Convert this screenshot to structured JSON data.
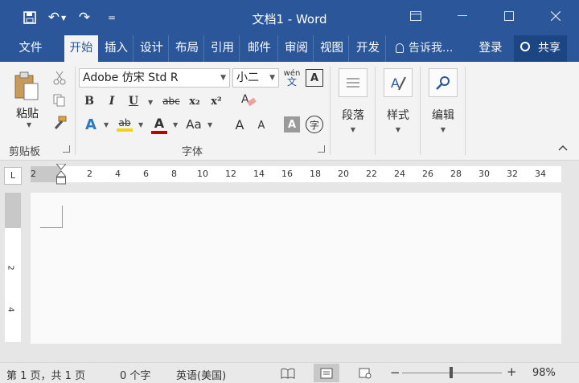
{
  "window": {
    "title": "文档1 - Word"
  },
  "qat": {
    "save": "💾",
    "undo": "↶",
    "redo": "↷",
    "customize": "="
  },
  "tabs": [
    "文件",
    "开始",
    "插入",
    "设计",
    "布局",
    "引用",
    "邮件",
    "审阅",
    "视图",
    "开发"
  ],
  "active_tab": "开始",
  "tellme": "告诉我...",
  "signin": "登录",
  "share": "共享",
  "clipboard": {
    "paste": "粘贴",
    "group": "剪贴板"
  },
  "font": {
    "name": "Adobe 仿宋 Std R",
    "size": "小二",
    "wen_pinyin": "wén",
    "wen_char": "文",
    "border_char": "A",
    "bold": "B",
    "italic": "I",
    "underline": "U",
    "strike": "abc",
    "sub": "x₂",
    "sup": "x²",
    "effects": "A",
    "highlight": "ab",
    "color": "A",
    "case": "Aa",
    "grow": "A",
    "shrink": "A",
    "shade": "A",
    "enclose": "字",
    "group": "字体"
  },
  "paragraph": {
    "label": "段落"
  },
  "styles": {
    "label": "样式"
  },
  "editing": {
    "label": "编辑"
  },
  "ruler": {
    "corner": "L",
    "h_ticks": [
      "2",
      "2",
      "4",
      "6",
      "8",
      "10",
      "12",
      "14",
      "16",
      "18",
      "20",
      "22",
      "24",
      "26",
      "28",
      "30",
      "32",
      "34"
    ],
    "v_ticks": [
      "2",
      "4"
    ]
  },
  "status": {
    "page": "第 1 页，共 1 页",
    "words": "0 个字",
    "lang": "英语(美国)",
    "zoom": "98%",
    "zoom_minus": "−",
    "zoom_plus": "+"
  },
  "zoom_level": 0.98,
  "colors": {
    "accent": "#2b579a",
    "highlight": "#f6d30f",
    "font_color": "#c00000"
  }
}
